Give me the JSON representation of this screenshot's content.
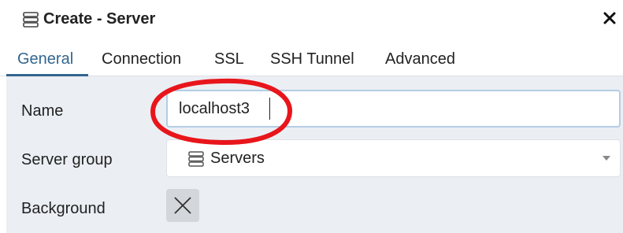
{
  "dialog": {
    "title": "Create - Server",
    "title_icon": "server-icon",
    "close_icon": "close-icon"
  },
  "tabs": [
    {
      "label": "General",
      "active": true
    },
    {
      "label": "Connection",
      "active": false
    },
    {
      "label": "SSL",
      "active": false
    },
    {
      "label": "SSH Tunnel",
      "active": false
    },
    {
      "label": "Advanced",
      "active": false
    }
  ],
  "form": {
    "name": {
      "label": "Name",
      "value": "localhost3"
    },
    "server_group": {
      "label": "Server group",
      "value": "Servers",
      "icon": "server-icon"
    },
    "background": {
      "label": "Background",
      "icon": "x-icon"
    }
  },
  "colors": {
    "accent": "#326690",
    "form_background": "#ebeef3",
    "annotation": "#e8151b"
  }
}
